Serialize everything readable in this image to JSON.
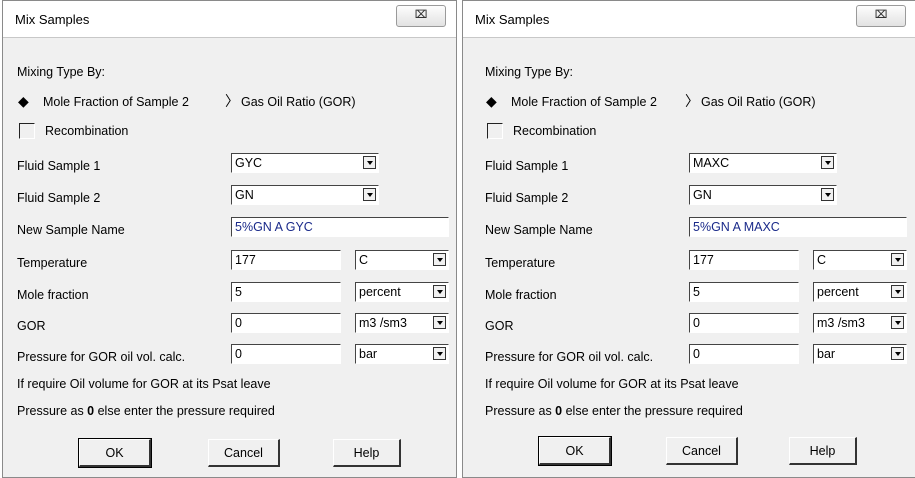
{
  "dialogs": [
    {
      "title": "Mix Samples",
      "close_label": "⌧",
      "mixing_type_label": "Mixing Type By:",
      "option_mole_fraction": "Mole Fraction of Sample 2",
      "option_gor": "Gas Oil Ratio (GOR)",
      "recombination_label": "Recombination",
      "fluid_sample_1_label": "Fluid Sample 1",
      "fluid_sample_1_value": "GYC",
      "fluid_sample_2_label": "Fluid Sample 2",
      "fluid_sample_2_value": "GN",
      "new_sample_name_label": "New Sample Name",
      "new_sample_name_value": "5%GN A GYC",
      "temperature_label": "Temperature",
      "temperature_value": "177",
      "temperature_unit": "C",
      "mole_fraction_label": "Mole fraction",
      "mole_fraction_value": "5",
      "mole_fraction_unit": "percent",
      "gor_label": "GOR",
      "gor_value": "0",
      "gor_unit": "m3 /sm3",
      "pressure_label": "Pressure for GOR oil vol. calc.",
      "pressure_value": "0",
      "pressure_unit": "bar",
      "note_line1": "If require Oil volume for GOR at its Psat leave",
      "note_line2_pre": "Pressure as ",
      "note_line2_bold": "0",
      "note_line2_post": " else enter the pressure required",
      "ok_label": "OK",
      "cancel_label": "Cancel",
      "help_label": "Help"
    },
    {
      "title": "Mix Samples",
      "close_label": "⌧",
      "mixing_type_label": "Mixing Type By:",
      "option_mole_fraction": "Mole Fraction of Sample 2",
      "option_gor": "Gas Oil Ratio (GOR)",
      "recombination_label": "Recombination",
      "fluid_sample_1_label": "Fluid Sample 1",
      "fluid_sample_1_value": "MAXC",
      "fluid_sample_2_label": "Fluid Sample 2",
      "fluid_sample_2_value": "GN",
      "new_sample_name_label": "New Sample Name",
      "new_sample_name_value": "5%GN A MAXC",
      "temperature_label": "Temperature",
      "temperature_value": "177",
      "temperature_unit": "C",
      "mole_fraction_label": "Mole fraction",
      "mole_fraction_value": "5",
      "mole_fraction_unit": "percent",
      "gor_label": "GOR",
      "gor_value": "0",
      "gor_unit": "m3 /sm3",
      "pressure_label": "Pressure for GOR oil vol. calc.",
      "pressure_value": "0",
      "pressure_unit": "bar",
      "note_line1": "If require Oil volume for GOR at its Psat leave",
      "note_line2_pre": "Pressure as ",
      "note_line2_bold": "0",
      "note_line2_post": " else enter the pressure required",
      "ok_label": "OK",
      "cancel_label": "Cancel",
      "help_label": "Help"
    }
  ],
  "icons": {
    "radio_selected": "diamond-filled",
    "radio_unselected": "chevron-right-outline",
    "close": "close-x"
  }
}
